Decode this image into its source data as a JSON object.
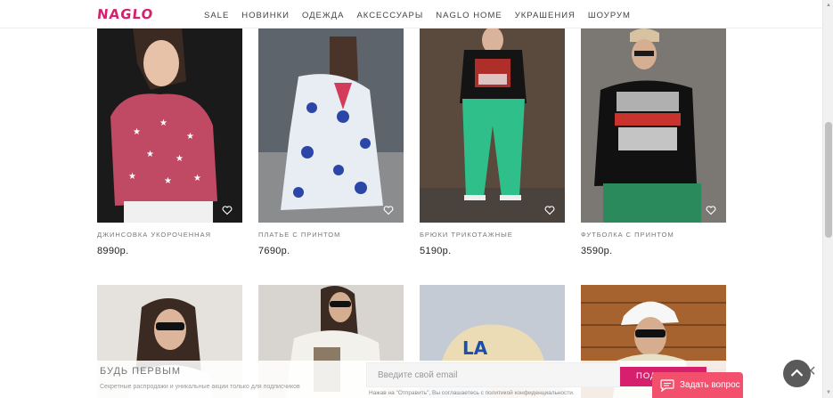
{
  "brand": {
    "logo": "NAGLO",
    "color": "#d6206e"
  },
  "nav": [
    {
      "label": "SALE"
    },
    {
      "label": "НОВИНКИ"
    },
    {
      "label": "ОДЕЖДА"
    },
    {
      "label": "АКСЕССУАРЫ"
    },
    {
      "label": "NAGLO HOME"
    },
    {
      "label": "УКРАШЕНИЯ"
    },
    {
      "label": "ШОУРУМ"
    }
  ],
  "products": [
    {
      "name": "ДЖИНСОВКА УКОРОЧЕННАЯ",
      "price": "8990р.",
      "favorite_icon": "heart-icon"
    },
    {
      "name": "ПЛАТЬЕ С ПРИНТОМ",
      "price": "7690р.",
      "favorite_icon": "heart-icon"
    },
    {
      "name": "БРЮКИ ТРИКОТАЖНЫЕ",
      "price": "5190р.",
      "favorite_icon": "heart-icon"
    },
    {
      "name": "ФУТБОЛКА С ПРИНТОМ",
      "price": "3590р.",
      "favorite_icon": "heart-icon"
    }
  ],
  "subscribe": {
    "title": "БУДЬ ПЕРВЫМ",
    "description": "Секретные распродажи и уникальные акции только для подписчиков",
    "email_placeholder": "Введите свой email",
    "send_label": "ПОДПИСАТЬСЯ",
    "legal": "Нажав на \"Отправить\", Вы соглашаетесь с политикой конфиденциальности."
  },
  "chat": {
    "label": "Задать вопрос",
    "color": "#f2506d"
  },
  "scroll_top_icon": "chevron-up-icon"
}
